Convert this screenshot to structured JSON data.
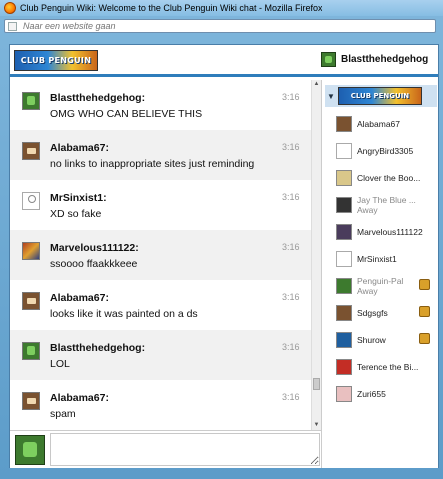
{
  "window": {
    "title": "Club Penguin Wiki: Welcome to the Club Penguin Wiki chat - Mozilla Firefox"
  },
  "address_bar": {
    "placeholder": "Naar een website gaan",
    "value": ""
  },
  "header": {
    "logo_text": "CLUB PENGUIN",
    "current_user": "Blastthehedgehog"
  },
  "messages": [
    {
      "user": "Blastthehedgehog:",
      "text": "OMG WHO CAN BELIEVE THIS",
      "time": "3:16"
    },
    {
      "user": "Alabama67:",
      "text": "no links to inappropriate sites just reminding",
      "time": "3:16"
    },
    {
      "user": "MrSinxist1:",
      "text": "XD so fake",
      "time": "3:16"
    },
    {
      "user": "Marvelous111122:",
      "text": "ssoooo ffaakkkeee",
      "time": "3:16"
    },
    {
      "user": "Alabama67:",
      "text": "looks like it was painted on a ds",
      "time": "3:16"
    },
    {
      "user": "Blastthehedgehog:",
      "text": "LOL",
      "time": "3:16"
    },
    {
      "user": "Alabama67:",
      "text": "spam",
      "time": "3:16"
    }
  ],
  "room": {
    "logo_text": "CLUB PENGUIN"
  },
  "users": [
    {
      "name": "Alabama67",
      "status": ""
    },
    {
      "name": "AngryBird3305",
      "status": ""
    },
    {
      "name": "Clover the Boo...",
      "status": ""
    },
    {
      "name": "Jay The Blue ...",
      "status": "Away"
    },
    {
      "name": "Marvelous111122",
      "status": ""
    },
    {
      "name": "MrSinxist1",
      "status": ""
    },
    {
      "name": "Penguin-Pal",
      "status": "Away"
    },
    {
      "name": "Sdgsgfs",
      "status": ""
    },
    {
      "name": "Shurow",
      "status": ""
    },
    {
      "name": "Terence the Bi...",
      "status": ""
    },
    {
      "name": "Zuri655",
      "status": ""
    }
  ],
  "chat_input": {
    "value": ""
  }
}
